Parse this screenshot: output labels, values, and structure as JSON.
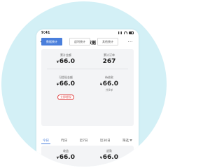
{
  "status_bar": {
    "time": "9:41"
  },
  "header": {
    "title": "经营数据",
    "more": "···"
  },
  "tabs": [
    {
      "label": "数据统计",
      "active": true
    },
    {
      "label": "返利统计",
      "active": false
    },
    {
      "label": "其他统计",
      "active": false
    }
  ],
  "summary": {
    "total_amount_label": "累计金额",
    "total_amount_value": "66.0",
    "total_orders_label": "累计订单",
    "total_orders_value": "267",
    "withdrawable_label": "可提现金额",
    "withdrawable_value": "66.0",
    "withdraw_button": "立即提现",
    "pending_label": "待收款",
    "pending_value": "66.0",
    "pending_count": "共8单",
    "currency": "¥"
  },
  "filters": [
    {
      "label": "今日",
      "active": true
    },
    {
      "label": "昨日",
      "active": false
    },
    {
      "label": "近7日",
      "active": false
    },
    {
      "label": "近30日",
      "active": false
    },
    {
      "label": "筛选",
      "active": false
    }
  ],
  "period": {
    "sales_label": "收益",
    "sales_value": "66.0",
    "refund_label": "退款",
    "refund_value": "66.0",
    "currency": "¥"
  },
  "colors": {
    "accent": "#4a7fdc",
    "alert": "#e04a4a",
    "background": "#d3f0f6"
  }
}
